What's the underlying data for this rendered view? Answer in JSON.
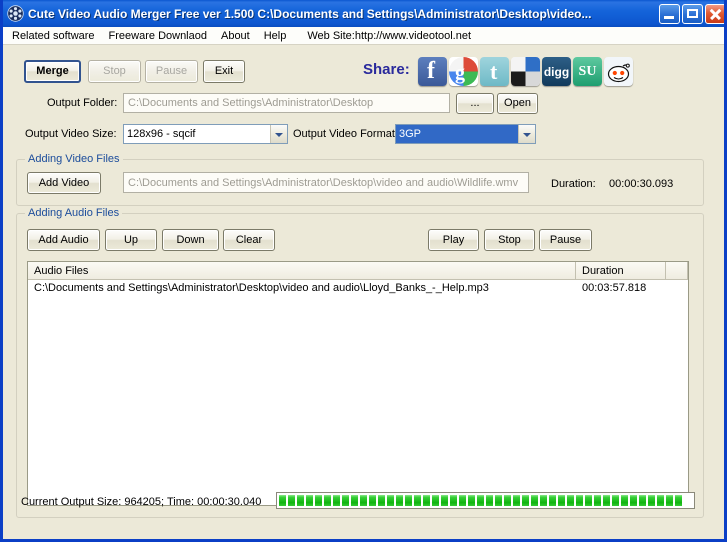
{
  "window": {
    "title": "Cute Video Audio Merger Free  ver 1.500  C:\\Documents and Settings\\Administrator\\Desktop\\video...",
    "icon": "film-reel-icon",
    "minimize_label": "Minimize",
    "maximize_label": "Maximize",
    "close_label": "Close",
    "accent_color": "#0b3fc6",
    "client_bg": "#ece9d8"
  },
  "menu": {
    "items": [
      {
        "label": "Related software"
      },
      {
        "label": "Freeware Downlaod"
      },
      {
        "label": "About"
      },
      {
        "label": "Help"
      },
      {
        "label": "Web Site:http://www.videotool.net"
      }
    ]
  },
  "toolbar": {
    "merge_label": "Merge",
    "stop_label": "Stop",
    "pause_label": "Pause",
    "exit_label": "Exit"
  },
  "share": {
    "label": "Share:",
    "icons": [
      {
        "name": "facebook-icon",
        "glyph": "f"
      },
      {
        "name": "google-icon",
        "glyph": "g"
      },
      {
        "name": "twitter-icon",
        "glyph": "t"
      },
      {
        "name": "windows-live-icon",
        "glyph": ""
      },
      {
        "name": "digg-icon",
        "glyph": "digg"
      },
      {
        "name": "stumbleupon-icon",
        "glyph": "SU"
      },
      {
        "name": "reddit-icon",
        "glyph": ""
      }
    ]
  },
  "output": {
    "folder_label": "Output Folder:",
    "folder_value": "C:\\Documents and Settings\\Administrator\\Desktop",
    "browse_label": "...",
    "open_label": "Open",
    "size_label": "Output Video Size:",
    "size_value": "128x96 - sqcif",
    "format_label": "Output Video Format:",
    "format_value": "3GP"
  },
  "video_group": {
    "title": "Adding Video Files",
    "add_label": "Add Video",
    "path_value": "C:\\Documents and Settings\\Administrator\\Desktop\\video and audio\\Wildlife.wmv",
    "duration_label": "Duration:",
    "duration_value": "00:00:30.093"
  },
  "audio_group": {
    "title": "Adding Audio Files",
    "add_label": "Add Audio",
    "up_label": "Up",
    "down_label": "Down",
    "clear_label": "Clear",
    "play_label": "Play",
    "stop_label": "Stop",
    "pause_label": "Pause",
    "columns": [
      "Audio Files",
      "Duration",
      ""
    ],
    "rows": [
      {
        "file": "C:\\Documents and Settings\\Administrator\\Desktop\\video and audio\\Lloyd_Banks_-_Help.mp3",
        "duration": "00:03:57.818",
        "extra": ""
      }
    ]
  },
  "status": {
    "text": "Current Output Size: 964205; Time: 00:00:30.040",
    "progress_percent": 100,
    "progress_color": "#22c422"
  }
}
